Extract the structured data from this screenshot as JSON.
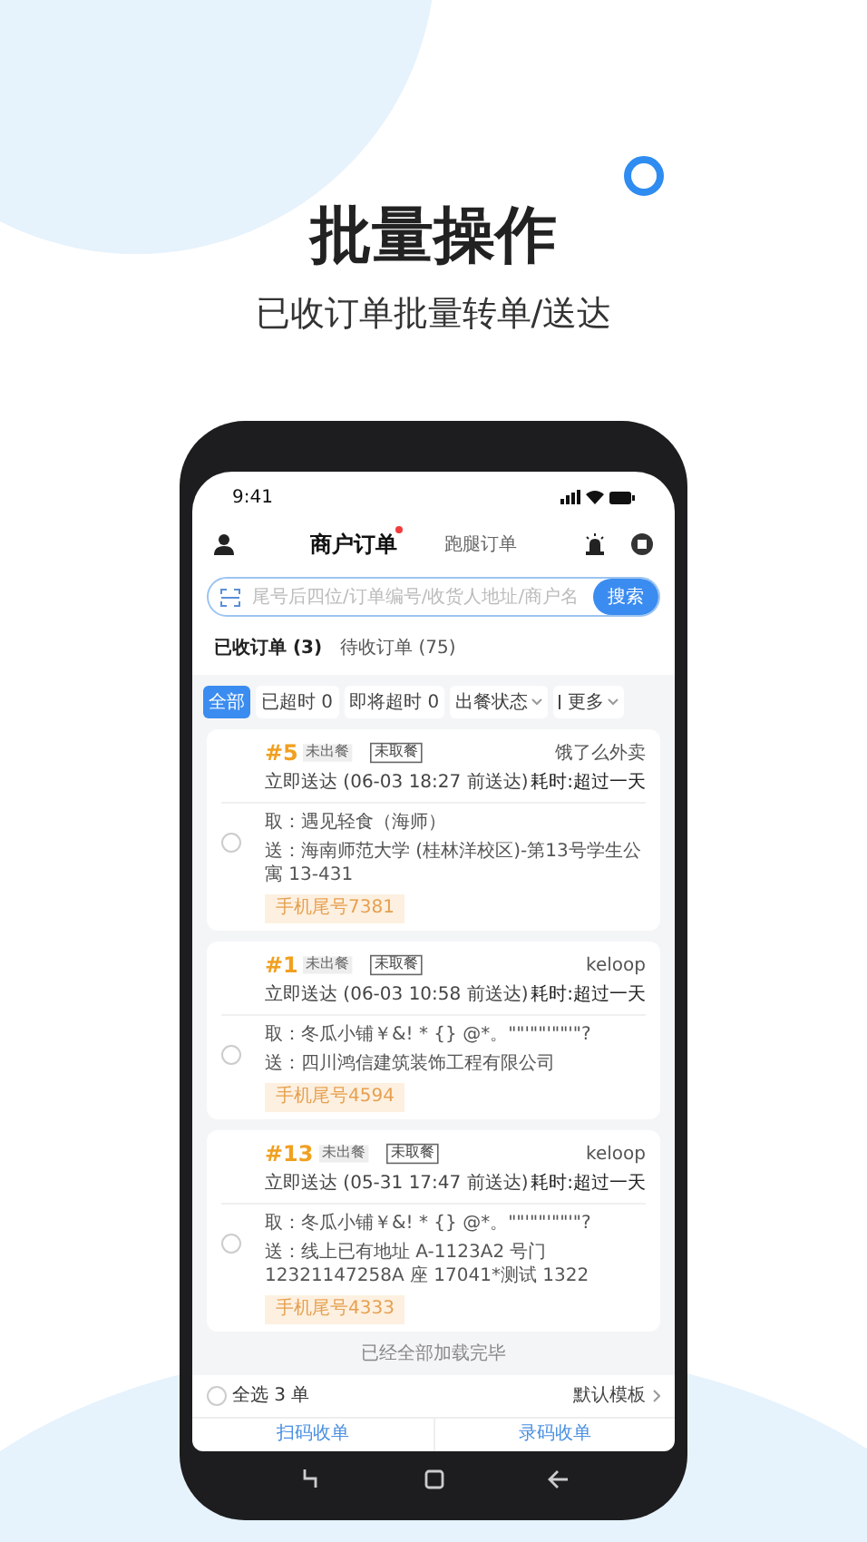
{
  "page": {
    "title": "批量操作",
    "subtitle": "已收订单批量转单/送达"
  },
  "status_bar": {
    "time": "9:41"
  },
  "header": {
    "tabs": [
      {
        "label": "商户订单",
        "selected": true,
        "dot": true
      },
      {
        "label": "跑腿订单",
        "selected": false,
        "dot": false
      }
    ]
  },
  "search": {
    "placeholder": "尾号后四位/订单编号/收货人地址/商户名",
    "button": "搜索"
  },
  "order_tabs": [
    {
      "label": "已收订单 (3)",
      "selected": true
    },
    {
      "label": "待收订单 (75)",
      "selected": false
    }
  ],
  "filters": [
    {
      "label": "全部",
      "selected": true,
      "kind": "chip"
    },
    {
      "label": "已超时 0",
      "selected": false,
      "kind": "chip"
    },
    {
      "label": "即将超时 0",
      "selected": false,
      "kind": "chip"
    },
    {
      "label": "出餐状态",
      "selected": false,
      "kind": "dropdown"
    },
    {
      "label": "更多",
      "selected": false,
      "kind": "more"
    }
  ],
  "orders": [
    {
      "number": "#5",
      "tags": [
        {
          "label": "未出餐",
          "kind": "filled"
        },
        {
          "label": "未取餐",
          "kind": "outline"
        }
      ],
      "source": "饿了么外卖",
      "deadline": "立即送达 (06-03 18:27 前送达)",
      "duration": "耗时:超过一天",
      "pickup": "取：遇见轻食（海师）",
      "dropoff": "送：海南师范大学 (桂林洋校区)-第13号学生公寓 13-431",
      "phone": "手机尾号7381",
      "checked": false
    },
    {
      "number": "#1",
      "tags": [
        {
          "label": "未出餐",
          "kind": "filled"
        },
        {
          "label": "未取餐",
          "kind": "outline"
        }
      ],
      "source": "keloop",
      "deadline": "立即送达 (06-03 10:58 前送达)",
      "duration": "耗时:超过一天",
      "pickup": "取：冬瓜小铺￥&! * {} @*。\"\"'\"\"'\"\"'\"?",
      "dropoff": "送：四川鸿信建筑装饰工程有限公司",
      "phone": "手机尾号4594",
      "checked": false
    },
    {
      "number": "#13",
      "tags": [
        {
          "label": "未出餐",
          "kind": "filled"
        },
        {
          "label": "未取餐",
          "kind": "outline"
        }
      ],
      "source": "keloop",
      "deadline": "立即送达 (05-31 17:47 前送达)",
      "duration": "耗时:超过一天",
      "pickup": "取：冬瓜小铺￥&! * {} @*。\"\"'\"\"'\"\"'\"?",
      "dropoff": "送：线上已有地址 A-1123A2 号门 12321147258A 座 17041*测试 1322",
      "phone": "手机尾号4333",
      "checked": false
    }
  ],
  "list_end": "已经全部加载完毕",
  "footer": {
    "select_all": {
      "label": "全选 3 单",
      "checked": false
    },
    "template": "默认模板",
    "buttons": [
      "扫码收单",
      "录码收单"
    ]
  }
}
